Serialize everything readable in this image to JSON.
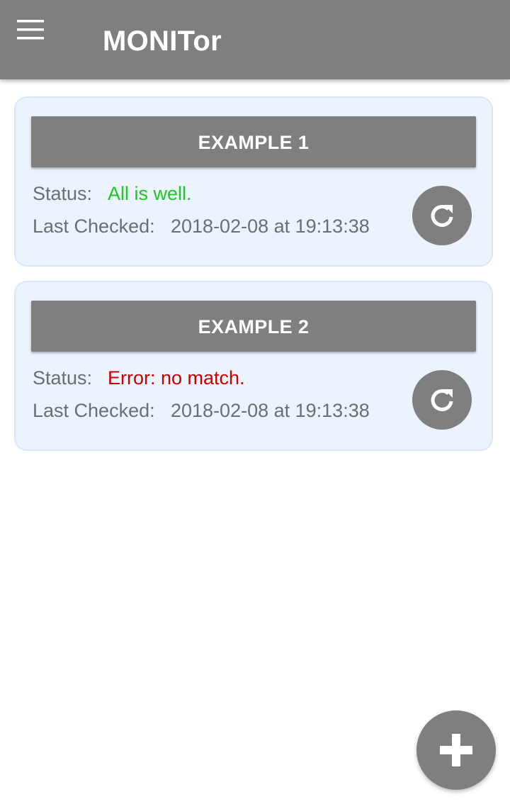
{
  "app_bar": {
    "title": "MONITor",
    "menu_icon": "hamburger-menu-icon",
    "background": "#7f7f7f"
  },
  "labels": {
    "status": "Status:",
    "last_checked": "Last Checked:"
  },
  "monitors": [
    {
      "name": "EXAMPLE 1",
      "status_text": "All is well.",
      "status_color": "#1ec81e",
      "last_checked": "2018-02-08 at 19:13:38",
      "refresh_icon": "refresh-icon"
    },
    {
      "name": "EXAMPLE 2",
      "status_text": "Error: no match.",
      "status_color": "#c80000",
      "last_checked": "2018-02-08 at 19:13:38",
      "refresh_icon": "refresh-icon"
    }
  ],
  "fab": {
    "icon": "plus-icon"
  },
  "colors": {
    "card_background": "#ebf3fe",
    "card_border": "#d9e7f8",
    "accent_gray": "#7f7f7f"
  }
}
